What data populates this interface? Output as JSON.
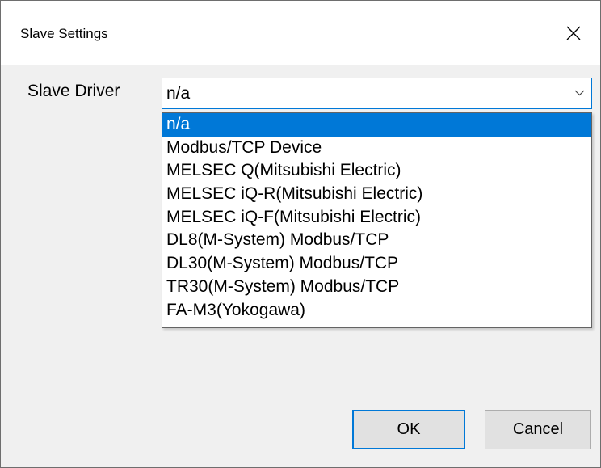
{
  "window": {
    "title": "Slave Settings"
  },
  "form": {
    "driver_label": "Slave Driver",
    "driver_value": "n/a",
    "driver_options": [
      "n/a",
      "Modbus/TCP Device",
      "MELSEC Q(Mitsubishi Electric)",
      "MELSEC iQ-R(Mitsubishi Electric)",
      "MELSEC iQ-F(Mitsubishi Electric)",
      "DL8(M-System) Modbus/TCP",
      "DL30(M-System) Modbus/TCP",
      "TR30(M-System) Modbus/TCP",
      "FA-M3(Yokogawa)"
    ],
    "selected_index": 0
  },
  "buttons": {
    "ok_label": "OK",
    "cancel_label": "Cancel"
  },
  "colors": {
    "accent": "#0078d7",
    "dialog_bg": "#f0f0f0"
  },
  "icons": {
    "close": "close-icon",
    "dropdown": "chevron-down-icon"
  }
}
